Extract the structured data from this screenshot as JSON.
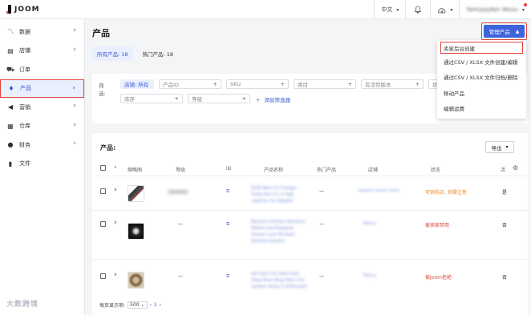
{
  "topbar": {
    "brand": "JOOM",
    "language": "中文",
    "user": "Yamujaydan Wuuu"
  },
  "sidebar": {
    "items": [
      {
        "label": "数据",
        "icon": "trend-icon",
        "has_children": true
      },
      {
        "label": "店铺",
        "icon": "store-icon",
        "has_children": true
      },
      {
        "label": "订单",
        "icon": "cart-icon",
        "has_children": false
      },
      {
        "label": "产品",
        "icon": "shirt-icon",
        "has_children": true,
        "active": true
      },
      {
        "label": "营销",
        "icon": "megaphone-icon",
        "has_children": true
      },
      {
        "label": "仓库",
        "icon": "warehouse-icon",
        "has_children": true
      },
      {
        "label": "财务",
        "icon": "dollar-icon",
        "has_children": true
      },
      {
        "label": "文件",
        "icon": "file-icon",
        "has_children": false
      }
    ],
    "watermark": "大数跨境"
  },
  "main": {
    "title": "产品",
    "manage_button": "管理产品",
    "subtabs": [
      "所有产品: 18",
      "热门产品: 18"
    ],
    "filter": {
      "label": "筛选:",
      "store": "店铺: 所有",
      "product_id": "产品ID",
      "sku": "SKU",
      "category": "类目",
      "active_version": "有活性版本",
      "status_short": "状",
      "stock": "库存",
      "grade": "等级",
      "add_filter": "添加筛选器"
    },
    "table": {
      "title": "产品:",
      "export": "导出",
      "columns": [
        "缩略图",
        "等级",
        "ID",
        "产品名称",
        "热门产品",
        "店铺",
        "状态",
        "活"
      ],
      "rows": [
        {
          "grade": "xxxxxx",
          "name": "2018 New Car Charger Three Port 3.1 A High capacity Car Adapter",
          "hot": "—",
          "store": "xxxxxx xxxxx xxxx",
          "status": "可供购买, 但需注意",
          "status_color": "orange",
          "active": "是"
        },
        {
          "grade": "—",
          "name": "Women's Fashion Necklace Mother and Daughter Forever Love Pendant Stainless Jewelry",
          "hot": "—",
          "store": "Fancy",
          "status": "被卖家禁用",
          "status_color": "red",
          "active": "否"
        },
        {
          "grade": "—",
          "name": "Hot Sale Chic New Punk Tribal Multi Wrap Men's PU Leather Hemp Cuff Bracelet",
          "hot": "—",
          "store": "Fancy",
          "status": "被Joom拒绝",
          "status_color": "red",
          "active": "否"
        }
      ]
    },
    "pager": {
      "per_page_label": "每页显示项:",
      "per_page": "500",
      "page": "1"
    }
  },
  "dropdown": {
    "items": [
      "卖家后台创建",
      "通过CSV / XLSX 文件创建/编辑",
      "通过CSV / XLSX 文件归档/删除",
      "移动产品",
      "编辑运费"
    ]
  }
}
